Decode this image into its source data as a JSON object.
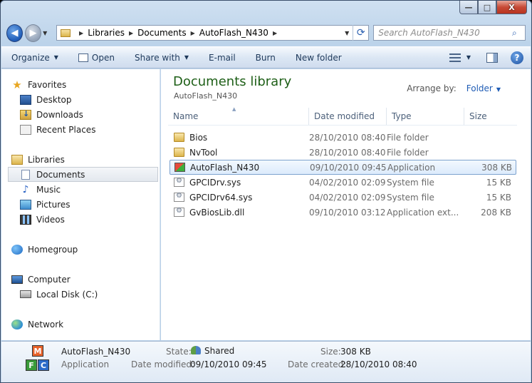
{
  "window": {
    "minimize": "—",
    "maximize": "□",
    "close": "X"
  },
  "nav": {
    "back_icon": "◀",
    "forward_icon": "▶",
    "breadcrumb": [
      "Libraries",
      "Documents",
      "AutoFlash_N430"
    ],
    "search_placeholder": "Search AutoFlash_N430"
  },
  "toolbar": {
    "organize": "Organize",
    "open": "Open",
    "share_with": "Share with",
    "email": "E-mail",
    "burn": "Burn",
    "new_folder": "New folder",
    "help": "?"
  },
  "sidebar": {
    "favorites": "Favorites",
    "desktop": "Desktop",
    "downloads": "Downloads",
    "recent_places": "Recent Places",
    "libraries": "Libraries",
    "documents": "Documents",
    "music": "Music",
    "pictures": "Pictures",
    "videos": "Videos",
    "homegroup": "Homegroup",
    "computer": "Computer",
    "local_disk": "Local Disk (C:)",
    "network": "Network"
  },
  "library": {
    "title": "Documents library",
    "subtitle": "AutoFlash_N430",
    "arrange_label": "Arrange by:",
    "arrange_value": "Folder"
  },
  "columns": {
    "name": "Name",
    "date": "Date modified",
    "type": "Type",
    "size": "Size"
  },
  "files": [
    {
      "name": "Bios",
      "date": "28/10/2010 08:40",
      "type": "File folder",
      "size": "",
      "icon": "folder-icon"
    },
    {
      "name": "NvTool",
      "date": "28/10/2010 08:40",
      "type": "File folder",
      "size": "",
      "icon": "folder-icon"
    },
    {
      "name": "AutoFlash_N430",
      "date": "09/10/2010 09:45",
      "type": "Application",
      "size": "308 KB",
      "icon": "application-icon"
    },
    {
      "name": "GPCIDrv.sys",
      "date": "04/02/2010 02:09",
      "type": "System file",
      "size": "15 KB",
      "icon": "system-file-icon"
    },
    {
      "name": "GPCIDrv64.sys",
      "date": "04/02/2010 02:09",
      "type": "System file",
      "size": "15 KB",
      "icon": "system-file-icon"
    },
    {
      "name": "GvBiosLib.dll",
      "date": "09/10/2010 03:12",
      "type": "Application ext...",
      "size": "208 KB",
      "icon": "dll-file-icon"
    }
  ],
  "details": {
    "name": "AutoFlash_N430",
    "kind": "Application",
    "state_label": "State:",
    "state_value": "Shared",
    "size_label": "Size:",
    "size_value": "308 KB",
    "modified_label": "Date modified:",
    "modified_value": "09/10/2010 09:45",
    "created_label": "Date created:",
    "created_value": "28/10/2010 08:40",
    "icon_letters": [
      "M",
      "F",
      "C"
    ]
  }
}
